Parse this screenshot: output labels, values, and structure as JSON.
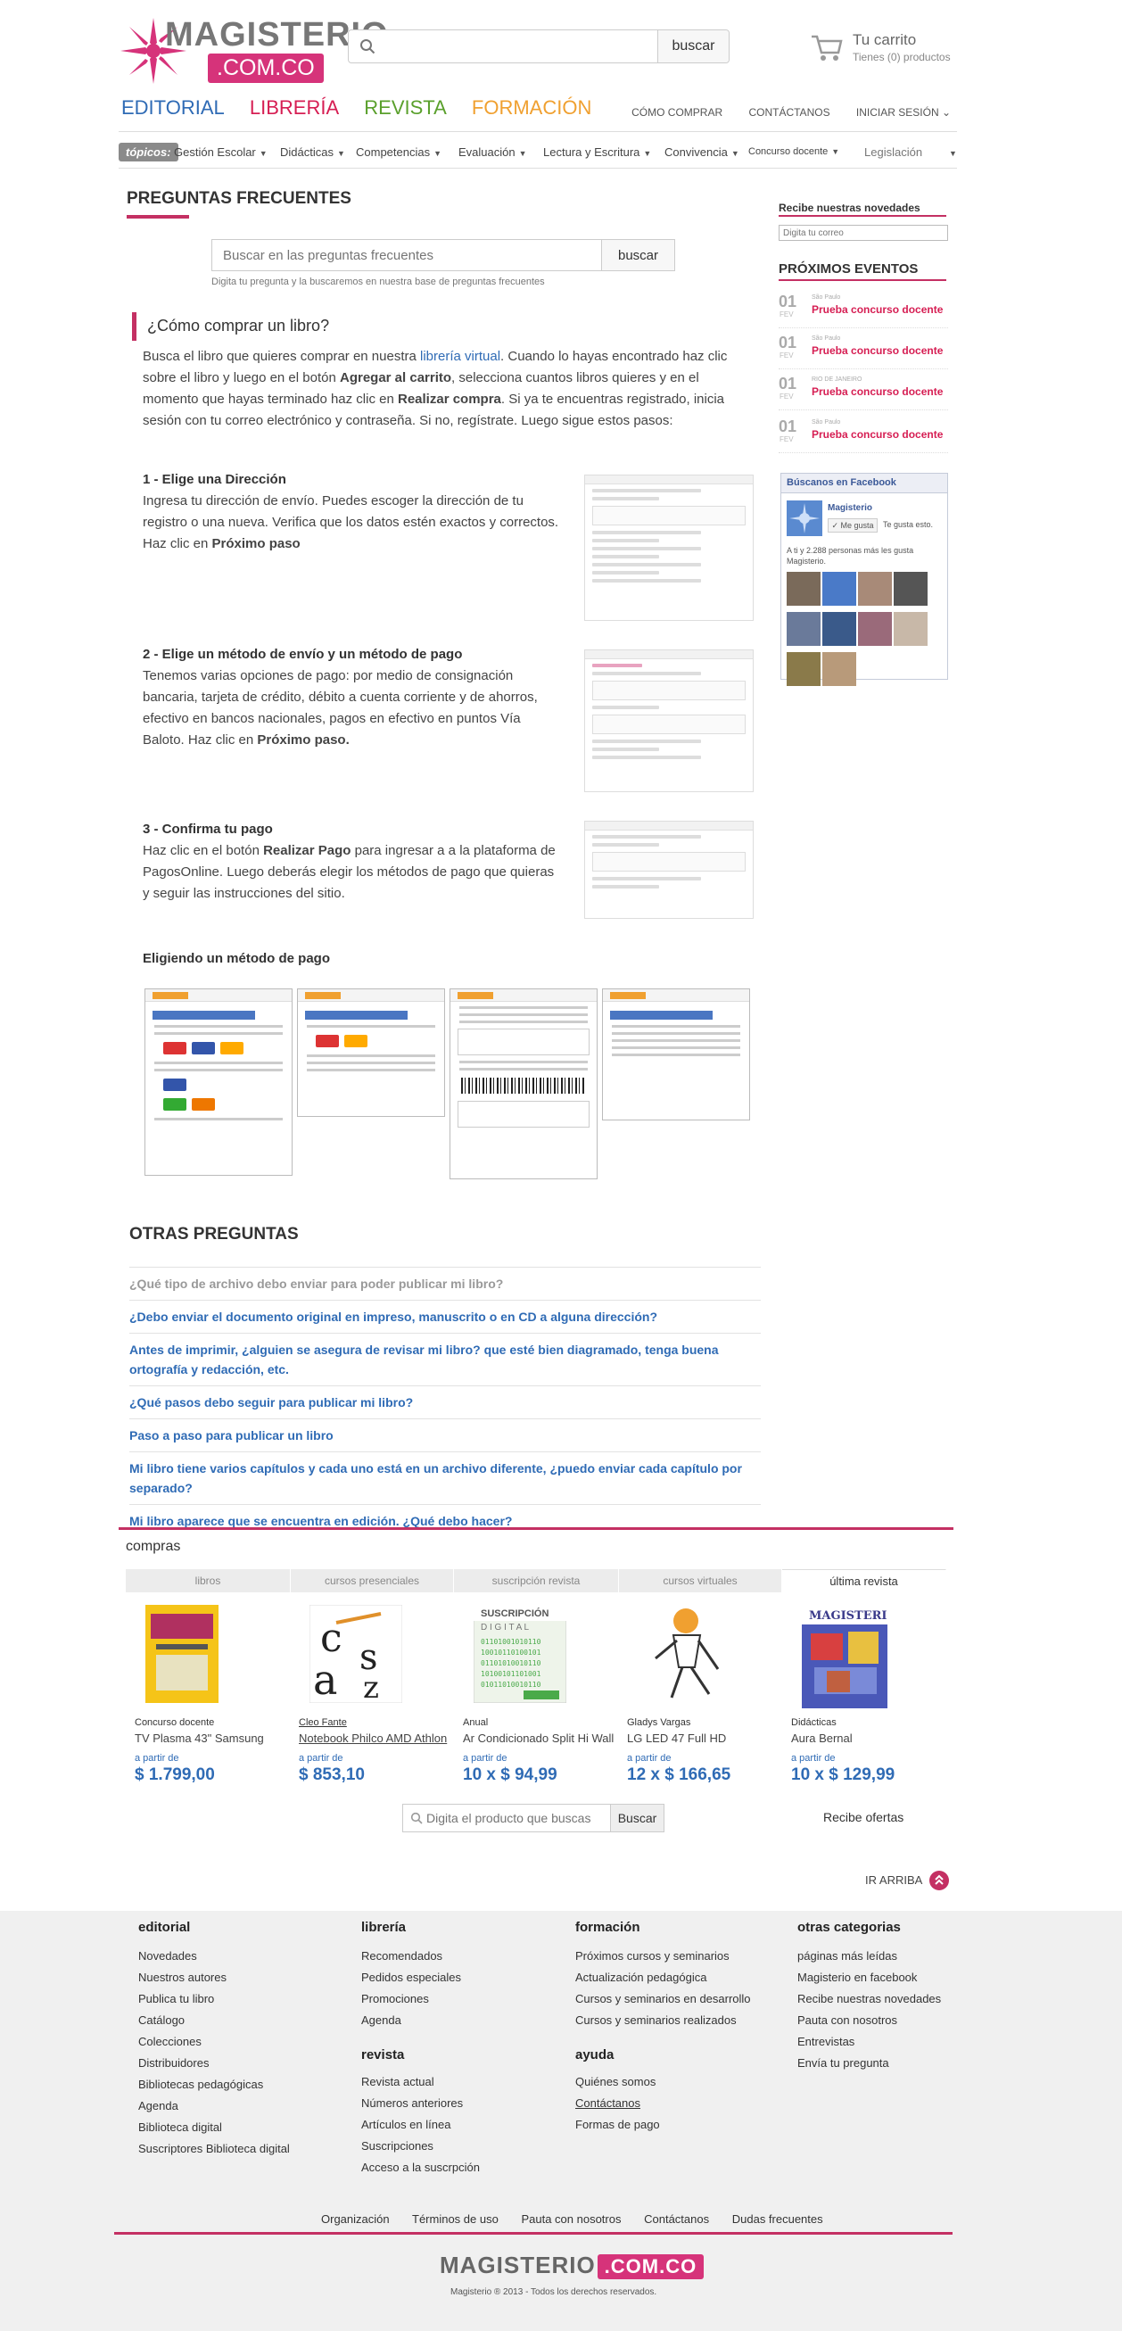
{
  "header": {
    "logo_text": "MAGISTERIO",
    "logo_com": ".COM.CO",
    "search_placeholder": "",
    "search_button": "buscar",
    "cart_title": "Tu carrito",
    "cart_sub": "Tienes (0) productos",
    "brand_nav": [
      {
        "label": "EDITORIAL",
        "color": "#2f6bb5"
      },
      {
        "label": "LIBRERÍA",
        "color": "#d61e53"
      },
      {
        "label": "REVISTA",
        "color": "#5aa02c"
      },
      {
        "label": "FORMACIÓN",
        "color": "#f0a030"
      }
    ],
    "top_links": [
      "CÓMO COMPRAR",
      "CONTÁCTANOS",
      "INICIAR SESIÓN ⌄"
    ]
  },
  "topics": {
    "label": "tópicos:",
    "items": [
      "Gestión Escolar",
      "Didácticas",
      "Competencias",
      "Evaluación",
      "Lectura y Escritura",
      "Convivencia",
      "Concurso docente",
      "Legislación"
    ]
  },
  "main": {
    "title": "PREGUNTAS FRECUENTES",
    "faq_search_placeholder": "Buscar en las preguntas frecuentes",
    "faq_search_button": "buscar",
    "faq_hint": "Digita tu pregunta y la buscaremos en nuestra base de preguntas frecuentes",
    "question": "¿Cómo comprar un libro?",
    "intro_a": "Busca el libro que quieres comprar en nuestra ",
    "intro_link": "librería virtual",
    "intro_b": ". Cuando lo hayas encontrado haz clic sobre el libro y luego en el botón ",
    "intro_c": "Agregar al carrito",
    "intro_d": ", selecciona cuantos libros quieres y en el momento que hayas terminado haz clic en ",
    "intro_e": "Realizar compra",
    "intro_f": ". Si ya te encuentras registrado, inicia sesión con tu correo electrónico y contraseña. Si no, regístrate. Luego sigue estos pasos:",
    "steps": [
      {
        "title": "1 - Elige una Dirección",
        "body_a": "Ingresa tu dirección de envío. Puedes escoger la dirección de tu registro o una nueva. Verifica que los datos estén exactos y correctos. Haz clic en ",
        "body_b": "Próximo paso"
      },
      {
        "title": "2 - Elige un método de envío y un método de pago",
        "body_a": "Tenemos varias opciones de pago: por medio de consignación bancaria, tarjeta de crédito, débito a cuenta corriente y de ahorros, efectivo en bancos nacionales, pagos en efectivo en puntos Vía Baloto. Haz clic en ",
        "body_b": "Próximo paso."
      },
      {
        "title": "3 - Confirma tu pago",
        "body_a": "Haz clic en el botón ",
        "body_b": "Realizar Pago",
        "body_c": " para ingresar a a la plataforma de PagosOnline. Luego deberás elegir los métodos de pago que quieras y seguir las instrucciones del sitio."
      }
    ],
    "choose_title": "Eligiendo un método de pago",
    "other_title": "OTRAS PREGUNTAS",
    "other_questions": [
      "¿Qué tipo de archivo debo enviar para poder publicar mi libro?",
      "¿Debo enviar el documento original en impreso, manuscrito o en CD a alguna dirección?",
      "Antes de imprimir, ¿alguien se asegura de revisar mi libro? que esté bien diagramado, tenga buena ortografía y redacción, etc.",
      "¿Qué pasos debo seguir para publicar mi libro?",
      "Paso a paso para publicar un libro",
      "Mi libro tiene varios capítulos y cada uno está en un archivo diferente, ¿puedo enviar cada capítulo por separado?",
      "Mi libro aparece que se encuentra en edición. ¿Qué debo hacer?"
    ]
  },
  "compras": {
    "title": "compras",
    "tabs": [
      "libros",
      "cursos presenciales",
      "suscripción revista",
      "cursos virtuales",
      "última revista"
    ],
    "products": [
      {
        "cat": "Concurso docente",
        "name": "TV Plasma 43\" Samsung",
        "from": "a partir de",
        "price": "$ 1.799,00"
      },
      {
        "cat": "Cleo Fante",
        "name": "Notebook Philco AMD Athlon",
        "from": "a partir de",
        "price": "$ 853,10"
      },
      {
        "cat": "Anual",
        "name": "Ar Condicionado Split Hi Wall",
        "from": "a partir de",
        "price": "10 x $ 94,99"
      },
      {
        "cat": "Gladys Vargas",
        "name": "LG LED 47 Full HD",
        "from": "a partir de",
        "price": "12 x $ 166,65"
      },
      {
        "cat": "Didácticas",
        "name": "Aura Bernal",
        "from": "a partir de",
        "price": "10 x $ 129,99"
      }
    ],
    "search_placeholder": "Digita el producto que buscas",
    "search_button": "Buscar",
    "recibe": "Recibe ofertas"
  },
  "ir_arriba": "IR ARRIBA",
  "sidebar": {
    "news_title": "Recibe nuestras novedades",
    "news_placeholder": "Digita tu correo",
    "events_title": "PRÓXIMOS EVENTOS",
    "events": [
      {
        "day": "01",
        "mon": "FEV",
        "meta": "São Paulo",
        "title": "Prueba concurso docente"
      },
      {
        "day": "01",
        "mon": "FEV",
        "meta": "São Paulo",
        "title": "Prueba concurso docente"
      },
      {
        "day": "01",
        "mon": "FEV",
        "meta": "RIO DE JANEIRO",
        "title": "Prueba concurso docente"
      },
      {
        "day": "01",
        "mon": "FEV",
        "meta": "São Paulo",
        "title": "Prueba concurso docente"
      }
    ],
    "fb_title": "Búscanos en Facebook",
    "fb_name": "Magisterio",
    "fb_like": "✓ Me gusta",
    "fb_like_text": "Te gusta esto.",
    "fb_count": "A ti y 2.288 personas más les gusta Magisterio."
  },
  "footer": {
    "columns": [
      {
        "title": "editorial",
        "items": [
          "Novedades",
          "Nuestros autores",
          "Publica tu libro",
          "Catálogo",
          "Colecciones",
          "Distribuidores",
          "Bibliotecas pedagógicas",
          "Agenda",
          "Biblioteca digital",
          "Suscriptores Biblioteca digital"
        ]
      },
      {
        "title": "librería",
        "items": [
          "Recomendados",
          "Pedidos especiales",
          "Promociones",
          "Agenda"
        ],
        "sub_title": "revista",
        "sub_items": [
          "Revista actual",
          "Números anteriores",
          "Artículos en línea",
          "Suscripciones",
          "Acceso a la suscrpción"
        ]
      },
      {
        "title": "formación",
        "items": [
          "Próximos cursos y seminarios",
          "Actualización pedagógica",
          "Cursos y seminarios en desarrollo",
          "Cursos y seminarios realizados"
        ],
        "sub_title": "ayuda",
        "sub_items": [
          "Quiénes somos",
          "Contáctanos",
          "Formas de pago"
        ]
      },
      {
        "title": "otras categorias",
        "items": [
          "páginas más leídas",
          "Magisterio en facebook",
          "Recibe nuestras novedades",
          "Pauta con nosotros",
          "Entrevistas",
          "Envía tu pregunta"
        ]
      }
    ],
    "bottom_links": [
      "Organización",
      "Términos de uso",
      "Pauta con nosotros",
      "Contáctanos",
      "Dudas frecuentes"
    ],
    "logo_text": "MAGISTERIO",
    "logo_com": ".COM.CO",
    "copyright": "Magisterio ® 2013 - Todos los derechos reservados."
  },
  "colors": {
    "brand_pink": "#c43063",
    "link_blue": "#2f6bb5"
  }
}
